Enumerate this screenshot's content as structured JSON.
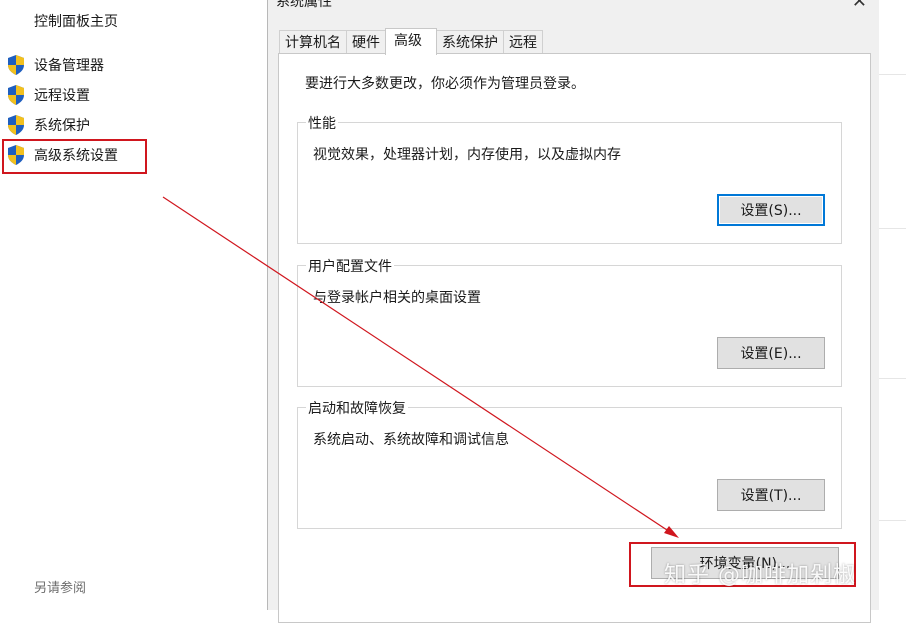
{
  "control_panel": {
    "home_label": "控制面板主页",
    "links": [
      {
        "label": "设备管理器",
        "icon": "uac-shield-icon"
      },
      {
        "label": "远程设置",
        "icon": "uac-shield-icon"
      },
      {
        "label": "系统保护",
        "icon": "uac-shield-icon"
      },
      {
        "label": "高级系统设置",
        "icon": "uac-shield-icon"
      }
    ],
    "see_also": "另请参阅"
  },
  "dialog": {
    "title": "系统属性",
    "close_glyph": "✕",
    "tabs": [
      {
        "label": "计算机名"
      },
      {
        "label": "硬件"
      },
      {
        "label": "高级",
        "active": true
      },
      {
        "label": "系统保护"
      },
      {
        "label": "远程"
      }
    ],
    "admin_note": "要进行大多数更改，你必须作为管理员登录。",
    "groups": {
      "performance": {
        "title": "性能",
        "description": "视觉效果，处理器计划，内存使用，以及虚拟内存",
        "button": "设置(S)..."
      },
      "user_profiles": {
        "title": "用户配置文件",
        "description": "与登录帐户相关的桌面设置",
        "button": "设置(E)..."
      },
      "startup_recovery": {
        "title": "启动和故障恢复",
        "description": "系统启动、系统故障和调试信息",
        "button": "设置(T)..."
      }
    },
    "env_button": "环境变量(N)..."
  },
  "annotation": {
    "highlight_color": "#d0161e",
    "arrow_color": "#d0161e"
  },
  "watermark": "知乎 @咖啡加剁椒"
}
